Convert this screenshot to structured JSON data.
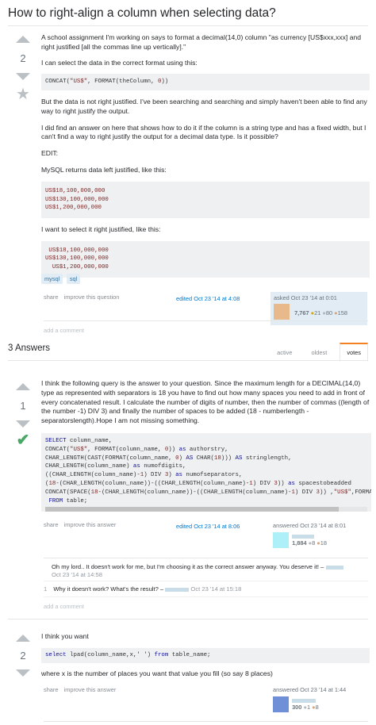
{
  "question": {
    "title": "How to right-align a column when selecting data?",
    "votes": "2",
    "p1": "A school assignment I'm working on says to format a decimal(14,0) column \"as currency [US$xxx,xxx] and right justified [all the commas line up vertically].\"",
    "p2": "I can select the data in the correct format using this:",
    "code1_pre": "CONCAT(",
    "code1_str": "\"US$\"",
    "code1_mid": ", FORMAT(theColumn, ",
    "code1_num": "0",
    "code1_post": "))",
    "p3": "But the data is not right justified. I've been searching and searching and simply haven't been able to find any way to right justify the output.",
    "p4": "I did find an answer on here that shows how to do it if the column is a string type and has a fixed width, but I can't find a way to right justify the output for a decimal data type. Is it possible?",
    "p5": "EDIT:",
    "p6": "MySQL returns data left justified, like this:",
    "code2_lines": [
      "US$18,100,000,000",
      "US$130,100,000,000",
      "US$1,200,000,000"
    ],
    "p7": "I want to select it right justified, like this:",
    "code3_lines": [
      " US$18,100,000,000",
      "US$130,100,000,000",
      "  US$1,200,000,000"
    ],
    "tags": [
      "mysql",
      "sql"
    ],
    "menu": [
      "share",
      "improve this question"
    ],
    "edited": "edited Oct 23 '14 at 4:08",
    "asked": "asked Oct 23 '14 at 0:01",
    "asker_rep": "7,767",
    "asker_gold": "21",
    "asker_silver": "80",
    "asker_bronze": "158",
    "add_comment": "add a comment"
  },
  "answers_header": "3 Answers",
  "tabs": [
    "active",
    "oldest",
    "votes"
  ],
  "answer1": {
    "votes": "1",
    "p1": "I think the following query is the answer to your question. Since the maximum length for a DECIMAL(14,0) type as represented with separators is 18 you have to find out how many spaces you need to add in front of every concatenated result. I calculate the number of digits of number, then the number of commas ((length of the number -1) DIV 3) and finally the number of spaces to be added (18 - numberlength - separatorslength).Hope I am not missing something.",
    "menu": [
      "share",
      "improve this answer"
    ],
    "edited": "edited Oct 23 '14 at 8:06",
    "answered": "answered Oct 23 '14 at 8:01",
    "rep": "1,884",
    "silver": "8",
    "bronze": "18",
    "comment1_text": "Oh my lord.. It doesn't work for me, but I'm choosing it as the correct answer anyway. You deserve it! –",
    "comment1_date": "Oct 23 '14 at 14:58",
    "comment2_score": "1",
    "comment2_text": "Why it doesn't work? What's the result? –",
    "comment2_date": "Oct 23 '14 at 15:18",
    "add_comment": "add a comment"
  },
  "answer2": {
    "votes": "2",
    "p1": "I think you want",
    "code_kw1": "select",
    "code_mid": " lpad(column_name,x,' ') ",
    "code_kw2": "from",
    "code_end": " table_name;",
    "p2": "where x is the number of places you want that value you fill (so say 8 places)",
    "menu": [
      "share",
      "improve this answer"
    ],
    "answered": "answered Oct 23 '14 at 1:44",
    "rep": "300",
    "silver": "1",
    "bronze": "8"
  },
  "colors": {
    "accent": "#0077cc",
    "tag_bg": "#e1ecf4",
    "accepted": "#48a868",
    "active_tab": "#f48024"
  }
}
